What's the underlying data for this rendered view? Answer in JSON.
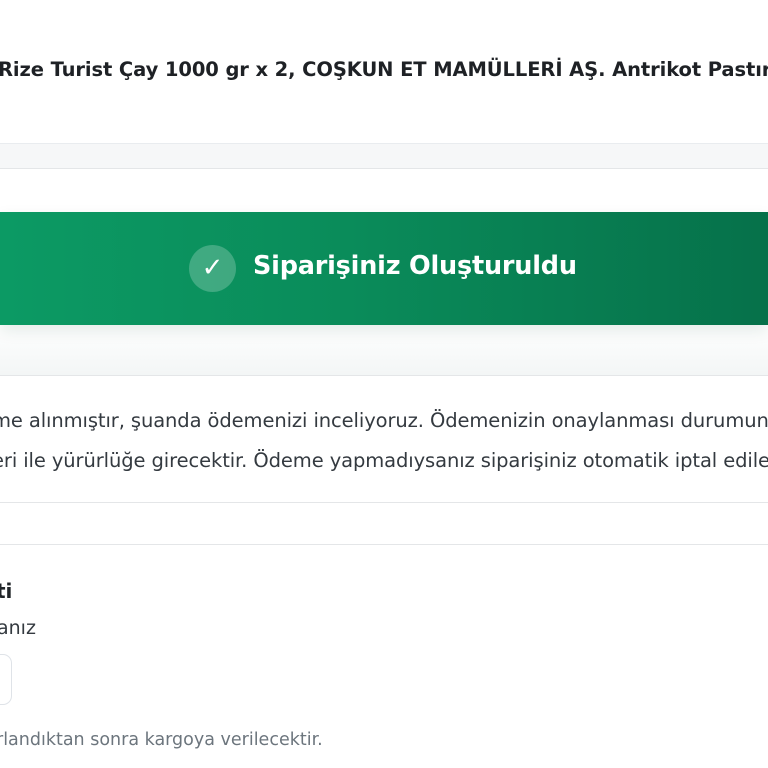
{
  "product_header": {
    "title": "Rize Turist Çay 1000 gr x 2, COŞKUN ET MAMÜLLERİ AŞ. Antrikot Pastırma"
  },
  "success_banner": {
    "icon": "check-icon",
    "icon_glyph": "✓",
    "title": "Siparişiniz Oluşturuldu",
    "colors": {
      "start": "#0c9a64",
      "end": "#06714a"
    }
  },
  "info": {
    "line_1": "me alınmıştır, şuanda ödemenizi inceliyoruz. Ödemenizin onaylanması durumunda",
    "line_2": "eri ile yürürlüğe girecektir. Ödeme yapmadıysanız siparişiniz otomatik iptal edilecektir."
  },
  "bottom": {
    "heading": "ti",
    "subtext": "anız",
    "note": "rlandıktan sonra kargoya verilecektir."
  }
}
